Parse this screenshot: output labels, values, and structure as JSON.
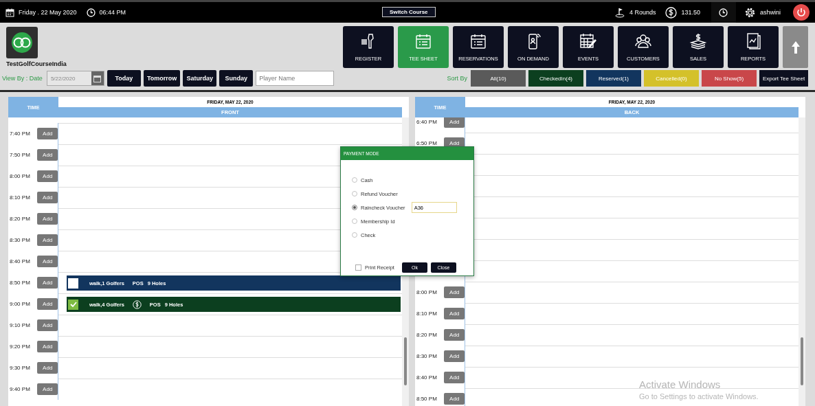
{
  "top_bar": {
    "date": "Friday .  22 May 2020",
    "time": "06:44 PM",
    "switch_course": "Switch Course",
    "rounds": "4 Rounds",
    "amount": "131.50",
    "user": "ashwini"
  },
  "course_name": "TestGolfCourseIndia",
  "view_by": {
    "label": "View By : Date",
    "date": "5/22/2020",
    "quick_dates": [
      "Today",
      "Tomorrow",
      "Saturday",
      "Sunday"
    ],
    "player_placeholder": "Player Name"
  },
  "nav_tiles": [
    {
      "kind": "register",
      "label": "REGISTER",
      "selected": false
    },
    {
      "kind": "teesheet",
      "label": "TEE SHEET",
      "selected": true
    },
    {
      "kind": "reservations",
      "label": "RESERVATIONS",
      "selected": false
    },
    {
      "kind": "ondemand",
      "label": "ON DEMAND",
      "selected": false
    },
    {
      "kind": "events",
      "label": "EVENTS",
      "selected": false
    },
    {
      "kind": "customers",
      "label": "CUSTOMERS",
      "selected": false
    },
    {
      "kind": "sales",
      "label": "SALES",
      "selected": false
    },
    {
      "kind": "reports",
      "label": "REPORTS",
      "selected": false
    }
  ],
  "sort": {
    "label": "Sort By",
    "filters": [
      {
        "label": "All(10)",
        "color": "#5a5a5a"
      },
      {
        "label": "CheckedIn(4)",
        "color": "#0c3f1f"
      },
      {
        "label": "Reserved(1)",
        "color": "#12355e"
      },
      {
        "label": "Cancelled(0)",
        "color": "#d4c12a"
      },
      {
        "label": "No Show(5)",
        "color": "#c9474a"
      }
    ],
    "export": "Export Tee Sheet"
  },
  "panels": [
    {
      "time_header": "TIME",
      "date": "FRIDAY, MAY 22, 2020",
      "course_side": "FRONT",
      "rows": [
        {
          "time": "7:40 PM",
          "add": "Add"
        },
        {
          "time": "7:50 PM",
          "add": "Add"
        },
        {
          "time": "8:00 PM",
          "add": "Add"
        },
        {
          "time": "8:10 PM",
          "add": "Add"
        },
        {
          "time": "8:20 PM",
          "add": "Add"
        },
        {
          "time": "8:30 PM",
          "add": "Add"
        },
        {
          "time": "8:40 PM",
          "add": "Add"
        },
        {
          "time": "8:50 PM",
          "add": "Add",
          "booking": {
            "players": "walk,1 Golfers",
            "paid": false,
            "source": "POS",
            "holes": "9 Holes",
            "checked": false,
            "color": "#12355e"
          }
        },
        {
          "time": "9:00 PM",
          "add": "Add",
          "booking": {
            "players": "walk,4 Golfers",
            "paid": true,
            "source": "POS",
            "holes": "9 Holes",
            "checked": true,
            "color": "#0c3f1f"
          }
        },
        {
          "time": "9:10 PM",
          "add": "Add"
        },
        {
          "time": "9:20 PM",
          "add": "Add"
        },
        {
          "time": "9:30 PM",
          "add": "Add"
        },
        {
          "time": "9:40 PM",
          "add": "Add"
        }
      ]
    },
    {
      "time_header": "TIME",
      "date": "FRIDAY, MAY 22, 2020",
      "course_side": "BACK",
      "rows": [
        {
          "time": "6:40 PM",
          "add": "Add"
        },
        {
          "time": "6:50 PM",
          "add": "Add"
        },
        {},
        {},
        {},
        {},
        {},
        {},
        {
          "time": "8:00 PM",
          "add": "Add"
        },
        {
          "time": "8:10 PM",
          "add": "Add"
        },
        {
          "time": "8:20 PM",
          "add": "Add"
        },
        {
          "time": "8:30 PM",
          "add": "Add"
        },
        {
          "time": "8:40 PM",
          "add": "Add"
        },
        {
          "time": "8:50 PM",
          "add": "Add"
        }
      ]
    }
  ],
  "payment_dialog": {
    "title": "PAYMENT MODE",
    "options": [
      {
        "label": "Cash",
        "selected": false
      },
      {
        "label": "Refund Voucher",
        "selected": false
      },
      {
        "label": "Raincheck Voucher",
        "selected": true,
        "value": "A36"
      },
      {
        "label": "Membership Id",
        "selected": false
      },
      {
        "label": "Check",
        "selected": false
      }
    ],
    "print_receipt": {
      "label": "Print Receipt",
      "checked": false
    },
    "ok": "Ok",
    "close": "Close"
  },
  "os_notice": {
    "title": "Activate Windows",
    "text": "Go to Settings to activate Windows."
  }
}
